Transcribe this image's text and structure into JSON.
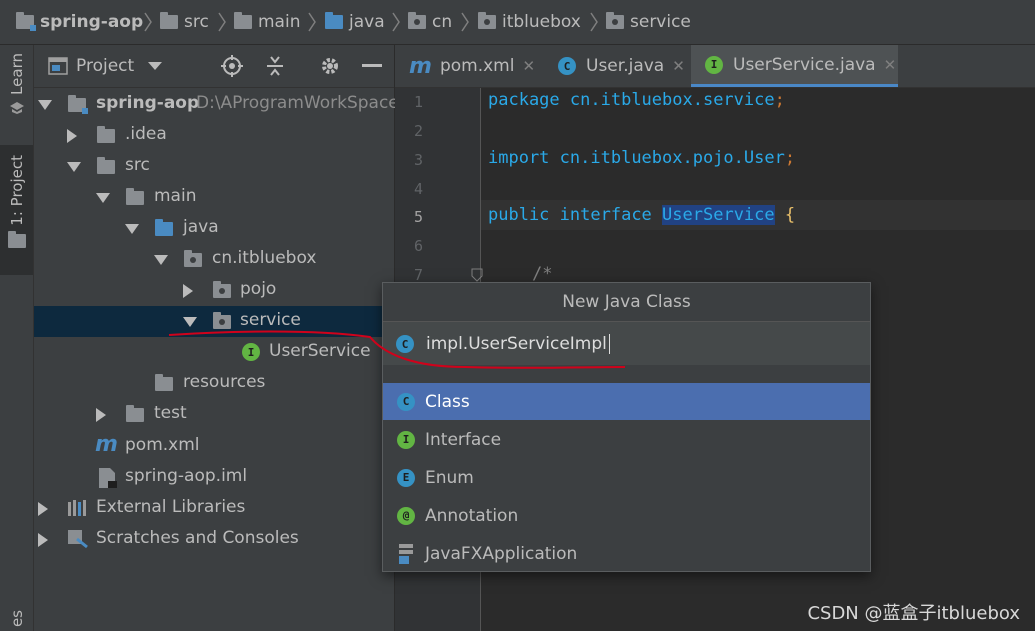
{
  "breadcrumb": {
    "items": [
      "spring-aop",
      "src",
      "main",
      "java",
      "cn",
      "itbluebox",
      "service"
    ]
  },
  "toolstrip": {
    "learn_label": "Learn",
    "project_label": "1: Project",
    "bottom_label": "es"
  },
  "project_panel": {
    "view_selector": "Project",
    "tree": [
      {
        "label": "spring-aop",
        "path": "D:\\AProgramWorkSpace\\"
      },
      {
        "label": ".idea"
      },
      {
        "label": "src"
      },
      {
        "label": "main"
      },
      {
        "label": "java"
      },
      {
        "label": "cn.itbluebox"
      },
      {
        "label": "pojo"
      },
      {
        "label": "service"
      },
      {
        "label": "UserService"
      },
      {
        "label": "resources"
      },
      {
        "label": "test"
      },
      {
        "label": "pom.xml"
      },
      {
        "label": "spring-aop.iml"
      },
      {
        "label": "External Libraries"
      },
      {
        "label": "Scratches and Consoles"
      }
    ]
  },
  "editor": {
    "tabs": [
      {
        "label": "pom.xml",
        "icon": "m"
      },
      {
        "label": "User.java",
        "icon": "C"
      },
      {
        "label": "UserService.java",
        "icon": "I"
      }
    ],
    "line_numbers": [
      "1",
      "2",
      "3",
      "4",
      "5",
      "6",
      "7"
    ],
    "code": {
      "line1_kw": "package",
      "line1_pkg": "cn.itbluebox.service",
      "line1_semi": ";",
      "line3_kw": "import",
      "line3_pkg": "cn.itbluebox.pojo.User",
      "line3_semi": ";",
      "line5_kw1": "public",
      "line5_kw2": "interface",
      "line5_name": "UserService",
      "line5_brace": "{",
      "line7_comment": "/*"
    }
  },
  "popup": {
    "title": "New Java Class",
    "input_value": "impl.UserServiceImpl",
    "kinds": [
      {
        "label": "Class",
        "icon": "C"
      },
      {
        "label": "Interface",
        "icon": "I"
      },
      {
        "label": "Enum",
        "icon": "E"
      },
      {
        "label": "Annotation",
        "icon": "@"
      },
      {
        "label": "JavaFXApplication",
        "icon": "javafx"
      }
    ]
  },
  "watermark": "CSDN @蓝盒子itbluebox",
  "colors": {
    "accent_selected": "#4b6eaf",
    "tree_selected": "#0d293e",
    "keyword": "#2aa9e8",
    "annotation_red": "#d0021b"
  }
}
